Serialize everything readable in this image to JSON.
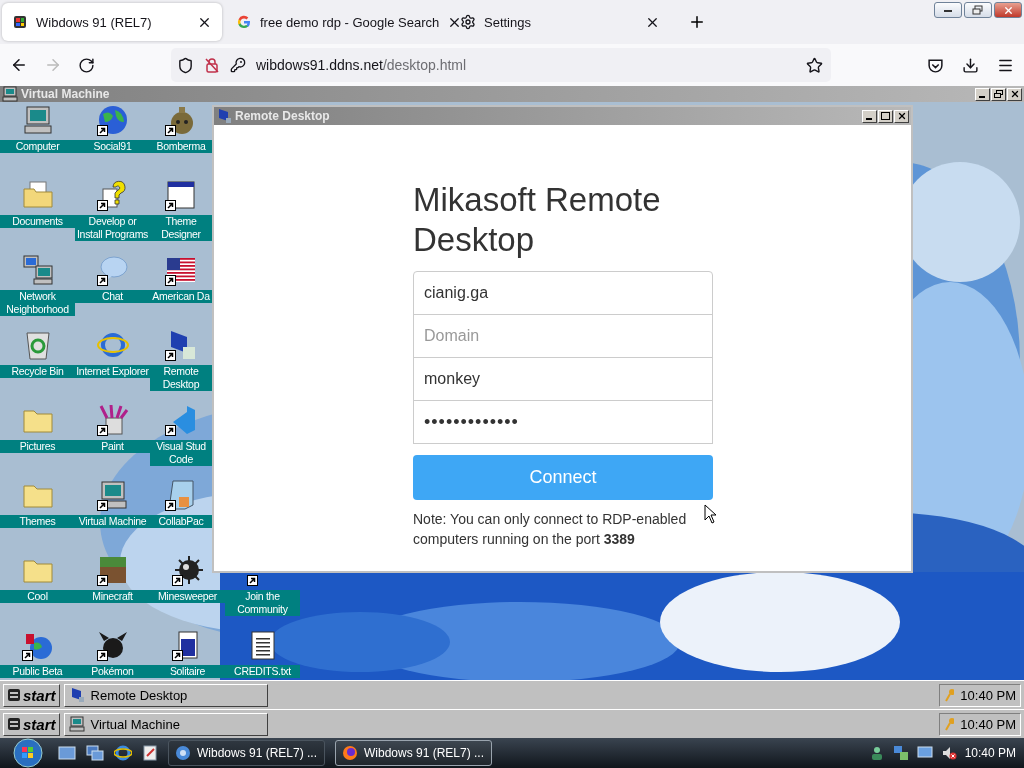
{
  "browser": {
    "tabs": [
      {
        "title": "Wibdows 91 (REL7)",
        "kind": "site",
        "selected": true
      },
      {
        "title": "free demo rdp - Google Search",
        "kind": "google",
        "selected": false
      },
      {
        "title": "Settings",
        "kind": "settings",
        "selected": false
      }
    ],
    "url": {
      "host": "wibdows91.ddns.net",
      "path": "/desktop.html"
    }
  },
  "vm_window": {
    "title": "Virtual Machine"
  },
  "desktop_rows": [
    [
      {
        "label": "Computer",
        "kind": "computer",
        "shortcut": false
      },
      {
        "label": "Social91",
        "kind": "globe",
        "shortcut": true
      },
      {
        "label": "Bomberma",
        "kind": "bomb",
        "shortcut": true
      }
    ],
    [
      {
        "label": "Documents",
        "kind": "docs",
        "shortcut": false
      },
      {
        "label": "Develop or Install Programs",
        "kind": "help",
        "shortcut": true
      },
      {
        "label": "Theme Designer",
        "kind": "window",
        "shortcut": true
      }
    ],
    [
      {
        "label": "Network Neighborhood",
        "kind": "network",
        "shortcut": false
      },
      {
        "label": "Chat",
        "kind": "chat",
        "shortcut": true
      },
      {
        "label": "American Da",
        "kind": "flag",
        "shortcut": true
      }
    ],
    [
      {
        "label": "Recycle Bin",
        "kind": "recycle",
        "shortcut": false
      },
      {
        "label": "Internet Explorer",
        "kind": "ie",
        "shortcut": false
      },
      {
        "label": "Remote Desktop",
        "kind": "remote",
        "shortcut": true
      }
    ],
    [
      {
        "label": "Pictures",
        "kind": "folder",
        "shortcut": false
      },
      {
        "label": "Paint",
        "kind": "paint",
        "shortcut": true
      },
      {
        "label": "Visual Stud Code",
        "kind": "vscode",
        "shortcut": true
      }
    ],
    [
      {
        "label": "Themes",
        "kind": "folder",
        "shortcut": false
      },
      {
        "label": "Virtual Machine",
        "kind": "computer",
        "shortcut": true
      },
      {
        "label": "CollabPac",
        "kind": "notepad",
        "shortcut": true
      }
    ],
    [
      {
        "label": "Cool",
        "kind": "folder",
        "shortcut": false
      },
      {
        "label": "Minecraft",
        "kind": "minecraft",
        "shortcut": true
      },
      {
        "label": "Minesweeper",
        "kind": "mine",
        "shortcut": true
      },
      {
        "label": "Join the Community",
        "kind": "hidden",
        "shortcut": true
      }
    ],
    [
      {
        "label": "Public Beta",
        "kind": "beta",
        "shortcut": true
      },
      {
        "label": "Pokémon",
        "kind": "pokemon",
        "shortcut": true
      },
      {
        "label": "Solitaire",
        "kind": "cards",
        "shortcut": true
      },
      {
        "label": "CREDITS.txt",
        "kind": "text",
        "shortcut": false
      }
    ]
  ],
  "remote_desktop": {
    "title": "Remote Desktop",
    "heading": "Mikasoft Remote Desktop",
    "fields": [
      {
        "kind": "text",
        "value": "cianig.ga"
      },
      {
        "kind": "text",
        "placeholder": "Domain"
      },
      {
        "kind": "text",
        "value": "monkey"
      },
      {
        "kind": "password",
        "value": "•••••••••••••"
      }
    ],
    "button": "Connect",
    "note": "Note: You can only connect to RDP-enabled computers running on the port **3389**"
  },
  "taskbars": [
    {
      "start": "start",
      "task": "Remote Desktop",
      "kind": "remote",
      "time": "10:40 PM"
    },
    {
      "start": "start",
      "task": "Virtual Machine",
      "kind": "computer",
      "time": "10:40 PM"
    }
  ],
  "os_taskbar": {
    "tasks": [
      {
        "title": "Wibdows 91 (REL7) ...",
        "kind": "chrome",
        "selected": false
      },
      {
        "title": "Wibdows 91 (REL7) ...",
        "kind": "firefox",
        "selected": true
      }
    ],
    "time": "10:40 PM"
  }
}
